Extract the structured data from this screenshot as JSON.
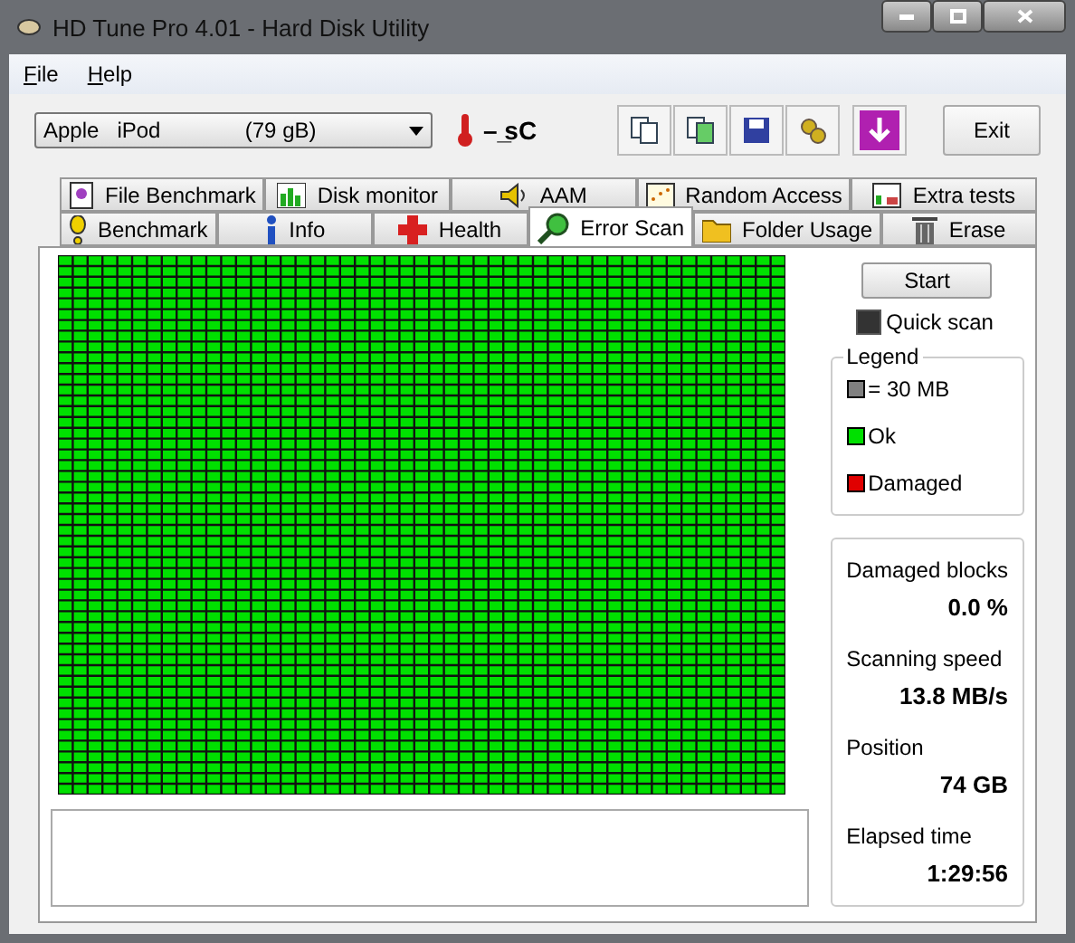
{
  "window": {
    "title": "HD Tune Pro 4.01 - Hard Disk Utility"
  },
  "menu": [
    "File",
    "Help"
  ],
  "drive_select": {
    "value": "Apple   iPod              (79 gB)"
  },
  "temperature": "– ̲sC",
  "exit_button": "Exit",
  "tab_rows": [
    [
      {
        "label": "File Benchmark",
        "selected": false
      },
      {
        "label": "Disk monitor",
        "selected": false
      },
      {
        "label": "AAM",
        "selected": false
      },
      {
        "label": "Random Access",
        "selected": false
      },
      {
        "label": "Extra tests",
        "selected": false
      }
    ],
    [
      {
        "label": "Benchmark",
        "selected": false
      },
      {
        "label": "Info",
        "selected": false
      },
      {
        "label": "Health",
        "selected": false
      },
      {
        "label": "Error Scan",
        "selected": true
      },
      {
        "label": "Folder Usage",
        "selected": false
      },
      {
        "label": "Erase",
        "selected": false
      }
    ]
  ],
  "scan": {
    "start_button": "Start",
    "quick_scan": {
      "label": "Quick scan",
      "checked": true
    },
    "legend": {
      "title": "Legend",
      "items": [
        {
          "label": "= 30 MB",
          "color": "#808080"
        },
        {
          "label": "Ok",
          "color": "#00e000"
        },
        {
          "label": "Damaged",
          "color": "#e00000"
        }
      ]
    },
    "stats": [
      {
        "label": "Damaged blocks",
        "value": "0.0 %"
      },
      {
        "label": "Scanning speed",
        "value": "13.8 MB/s"
      },
      {
        "label": "Position",
        "value": "74 GB"
      },
      {
        "label": "Elapsed time",
        "value": "1:29:56"
      }
    ]
  }
}
